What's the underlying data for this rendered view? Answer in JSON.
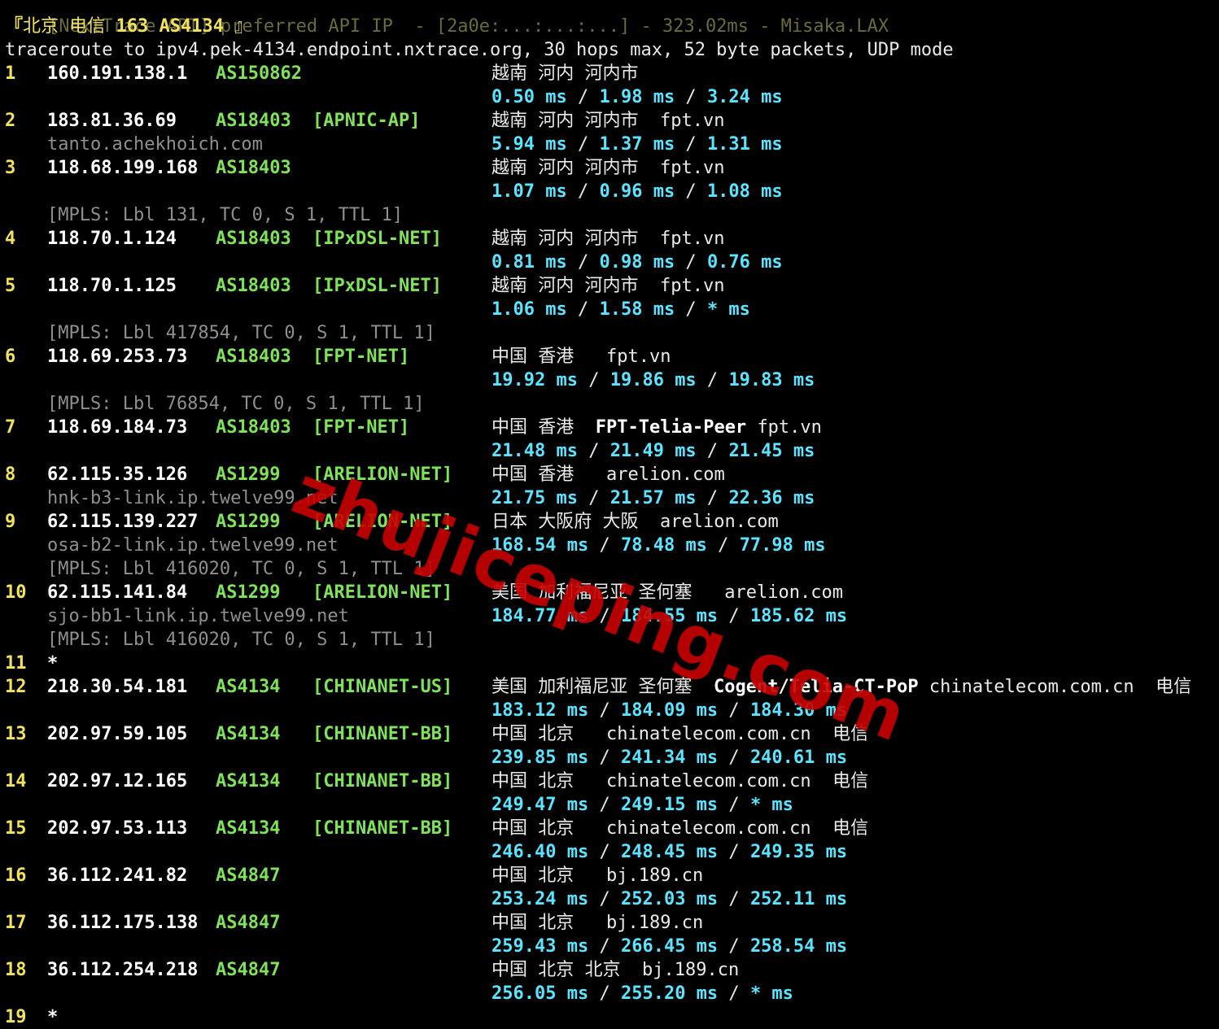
{
  "top_line": {
    "left": "[NextTrace API] preferred API IP",
    "middle": "- [2a0e:...:...:...] - 323.02ms - Misaka.LAX"
  },
  "target_header": {
    "open": "『",
    "city": "北京",
    "isp": "电信",
    "num": "163",
    "asn": "AS4134",
    "close": " 』"
  },
  "trace_line": "traceroute to ipv4.pek-4134.endpoint.nxtrace.org, 30 hops max, 52 byte packets, UDP mode",
  "hops": [
    {
      "hop": "1",
      "ip": "160.191.138.1",
      "asn": "AS150862",
      "net": "",
      "geo": "越南 河内 河内市",
      "tag": "",
      "domain": "",
      "isp": "",
      "host": "",
      "mpls": "",
      "lat": [
        "0.50 ms",
        "1.98 ms",
        "3.24 ms"
      ]
    },
    {
      "hop": "2",
      "ip": "183.81.36.69",
      "asn": "AS18403",
      "net": "[APNIC-AP]",
      "geo": "越南 河内 河内市",
      "tag": "",
      "domain": "fpt.vn",
      "isp": "",
      "host": "tanto.achekhoich.com",
      "mpls": "",
      "lat": [
        "5.94 ms",
        "1.37 ms",
        "1.31 ms"
      ]
    },
    {
      "hop": "3",
      "ip": "118.68.199.168",
      "asn": "AS18403",
      "net": "",
      "geo": "越南 河内 河内市",
      "tag": "",
      "domain": "fpt.vn",
      "isp": "",
      "host": "",
      "mpls": "[MPLS: Lbl 131, TC 0, S 1, TTL 1]",
      "lat": [
        "1.07 ms",
        "0.96 ms",
        "1.08 ms"
      ]
    },
    {
      "hop": "4",
      "ip": "118.70.1.124",
      "asn": "AS18403",
      "net": "[IPxDSL-NET]",
      "geo": "越南 河内 河内市",
      "tag": "",
      "domain": "fpt.vn",
      "isp": "",
      "host": "",
      "mpls": "",
      "lat": [
        "0.81 ms",
        "0.98 ms",
        "0.76 ms"
      ]
    },
    {
      "hop": "5",
      "ip": "118.70.1.125",
      "asn": "AS18403",
      "net": "[IPxDSL-NET]",
      "geo": "越南 河内 河内市",
      "tag": "",
      "domain": "fpt.vn",
      "isp": "",
      "host": "",
      "mpls": "[MPLS: Lbl 417854, TC 0, S 1, TTL 1]",
      "lat": [
        "1.06 ms",
        "1.58 ms",
        "* ms"
      ]
    },
    {
      "hop": "6",
      "ip": "118.69.253.73",
      "asn": "AS18403",
      "net": "[FPT-NET]",
      "geo": "中国 香港 ",
      "tag": "",
      "domain": "fpt.vn",
      "isp": "",
      "host": "",
      "mpls": "[MPLS: Lbl 76854, TC 0, S 1, TTL 1]",
      "lat": [
        "19.92 ms",
        "19.86 ms",
        "19.83 ms"
      ]
    },
    {
      "hop": "7",
      "ip": "118.69.184.73",
      "asn": "AS18403",
      "net": "[FPT-NET]",
      "geo": "中国 香港",
      "tag": "FPT-Telia-Peer",
      "domain": "fpt.vn",
      "isp": "",
      "host": "",
      "mpls": "",
      "lat": [
        "21.48 ms",
        "21.49 ms",
        "21.45 ms"
      ]
    },
    {
      "hop": "8",
      "ip": "62.115.35.126",
      "asn": "AS1299",
      "net": "[ARELION-NET]",
      "geo": "中国 香港 ",
      "tag": "",
      "domain": "arelion.com",
      "isp": "",
      "host": "hnk-b3-link.ip.twelve99.net",
      "mpls": "",
      "lat": [
        "21.75 ms",
        "21.57 ms",
        "22.36 ms"
      ]
    },
    {
      "hop": "9",
      "ip": "62.115.139.227",
      "asn": "AS1299",
      "net": "[ARELION-NET]",
      "geo": "日本 大阪府 大阪",
      "tag": "",
      "domain": "arelion.com",
      "isp": "",
      "host": "osa-b2-link.ip.twelve99.net",
      "mpls": "[MPLS: Lbl 416020, TC 0, S 1, TTL 1]",
      "lat": [
        "168.54 ms",
        "78.48 ms",
        "77.98 ms"
      ]
    },
    {
      "hop": "10",
      "ip": "62.115.141.84",
      "asn": "AS1299",
      "net": "[ARELION-NET]",
      "geo": "美国 加利福尼亚 圣何塞 ",
      "tag": "",
      "domain": "arelion.com",
      "isp": "",
      "host": "sjo-bb1-link.ip.twelve99.net",
      "mpls": "[MPLS: Lbl 416020, TC 0, S 1, TTL 1]",
      "lat": [
        "184.77 ms",
        "184.55 ms",
        "185.62 ms"
      ]
    },
    {
      "hop": "11",
      "ip": "*",
      "asn": "",
      "net": "",
      "geo": "",
      "tag": "",
      "domain": "",
      "isp": "",
      "host": "",
      "mpls": "",
      "lat": []
    },
    {
      "hop": "12",
      "ip": "218.30.54.181",
      "asn": "AS4134",
      "net": "[CHINANET-US]",
      "geo": "美国 加利福尼亚 圣何塞",
      "tag": "Cogent/Telia-CT-PoP",
      "domain": "chinatelecom.com.cn",
      "isp": "电信",
      "host": "",
      "mpls": "",
      "lat": [
        "183.12 ms",
        "184.09 ms",
        "184.30 ms"
      ]
    },
    {
      "hop": "13",
      "ip": "202.97.59.105",
      "asn": "AS4134",
      "net": "[CHINANET-BB]",
      "geo": "中国 北京 ",
      "tag": "",
      "domain": "chinatelecom.com.cn",
      "isp": "电信",
      "host": "",
      "mpls": "",
      "lat": [
        "239.85 ms",
        "241.34 ms",
        "240.61 ms"
      ]
    },
    {
      "hop": "14",
      "ip": "202.97.12.165",
      "asn": "AS4134",
      "net": "[CHINANET-BB]",
      "geo": "中国 北京 ",
      "tag": "",
      "domain": "chinatelecom.com.cn",
      "isp": "电信",
      "host": "",
      "mpls": "",
      "lat": [
        "249.47 ms",
        "249.15 ms",
        "* ms"
      ]
    },
    {
      "hop": "15",
      "ip": "202.97.53.113",
      "asn": "AS4134",
      "net": "[CHINANET-BB]",
      "geo": "中国 北京 ",
      "tag": "",
      "domain": "chinatelecom.com.cn",
      "isp": "电信",
      "host": "",
      "mpls": "",
      "lat": [
        "246.40 ms",
        "248.45 ms",
        "249.35 ms"
      ]
    },
    {
      "hop": "16",
      "ip": "36.112.241.82",
      "asn": "AS4847",
      "net": "",
      "geo": "中国 北京 ",
      "tag": "",
      "domain": "bj.189.cn",
      "isp": "",
      "host": "",
      "mpls": "",
      "lat": [
        "253.24 ms",
        "252.03 ms",
        "252.11 ms"
      ]
    },
    {
      "hop": "17",
      "ip": "36.112.175.138",
      "asn": "AS4847",
      "net": "",
      "geo": "中国 北京 ",
      "tag": "",
      "domain": "bj.189.cn",
      "isp": "",
      "host": "",
      "mpls": "",
      "lat": [
        "259.43 ms",
        "266.45 ms",
        "258.54 ms"
      ]
    },
    {
      "hop": "18",
      "ip": "36.112.254.218",
      "asn": "AS4847",
      "net": "",
      "geo": "中国 北京 北京",
      "tag": "",
      "domain": "bj.189.cn",
      "isp": "",
      "host": "",
      "mpls": "",
      "lat": [
        "256.05 ms",
        "255.20 ms",
        "* ms"
      ]
    },
    {
      "hop": "19",
      "ip": "*",
      "asn": "",
      "net": "",
      "geo": "",
      "tag": "",
      "domain": "",
      "isp": "",
      "host": "",
      "mpls": "",
      "lat": []
    }
  ],
  "watermark": "zhujiceping.com",
  "colors": {
    "background": "#000000",
    "hop": "#f2e35a",
    "ip": "#ffffff",
    "asn": "#7fe35a",
    "latency": "#5be4ff",
    "muted": "#8f8f8f",
    "watermark": "#c80000"
  }
}
